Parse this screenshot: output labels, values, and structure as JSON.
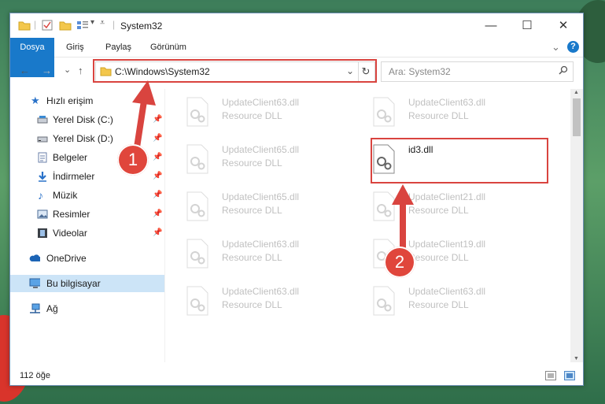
{
  "window": {
    "title": "System32",
    "controls": {
      "minimize": "—",
      "maximize": "☐",
      "close": "✕"
    }
  },
  "ribbon": {
    "tabs": [
      "Dosya",
      "Giriş",
      "Paylaş",
      "Görünüm"
    ],
    "collapse_glyph": "⌄",
    "help_glyph": "?"
  },
  "address": {
    "path": "C:\\Windows\\System32",
    "search_placeholder": "Ara: System32",
    "dropdown_glyph": "⌄",
    "refresh_glyph": "↻"
  },
  "nav_buttons": {
    "back": "←",
    "forward": "→",
    "recent": "⌄",
    "up": "↑"
  },
  "sidebar": {
    "items": [
      {
        "label": "Hızlı erişim",
        "icon": "star-icon",
        "pinned": false
      },
      {
        "label": "Yerel Disk (C:)",
        "icon": "drive-icon",
        "pinned": true
      },
      {
        "label": "Yerel Disk (D:)",
        "icon": "drive-icon",
        "pinned": true
      },
      {
        "label": "Belgeler",
        "icon": "documents-icon",
        "pinned": true
      },
      {
        "label": "İndirmeler",
        "icon": "download-icon",
        "pinned": true
      },
      {
        "label": "Müzik",
        "icon": "music-icon",
        "pinned": true
      },
      {
        "label": "Resimler",
        "icon": "pictures-icon",
        "pinned": true
      },
      {
        "label": "Videolar",
        "icon": "video-icon",
        "pinned": true
      },
      {
        "label": "OneDrive",
        "icon": "cloud-icon",
        "pinned": false
      },
      {
        "label": "Bu bilgisayar",
        "icon": "computer-icon",
        "pinned": false,
        "selected": true
      },
      {
        "label": "Ağ",
        "icon": "network-icon",
        "pinned": false
      }
    ],
    "pin_glyph": "📌"
  },
  "files": [
    {
      "name": "UpdateClient63.dll",
      "type": "Resource DLL",
      "highlighted": false
    },
    {
      "name": "UpdateClient63.dll",
      "type": "Resource DLL",
      "highlighted": false
    },
    {
      "name": "UpdateClient65.dll",
      "type": "Resource DLL",
      "highlighted": false
    },
    {
      "name": "id3.dll",
      "type": "",
      "highlighted": true
    },
    {
      "name": "UpdateClient65.dll",
      "type": "Resource DLL",
      "highlighted": false
    },
    {
      "name": "UpdateClient21.dll",
      "type": "Resource DLL",
      "highlighted": false
    },
    {
      "name": "UpdateClient63.dll",
      "type": "Resource DLL",
      "highlighted": false
    },
    {
      "name": "UpdateClient19.dll",
      "type": "Resource DLL",
      "highlighted": false
    },
    {
      "name": "UpdateClient63.dll",
      "type": "Resource DLL",
      "highlighted": false
    },
    {
      "name": "UpdateClient63.dll",
      "type": "Resource DLL",
      "highlighted": false
    }
  ],
  "status": {
    "item_count": "112 öğe"
  },
  "annotations": {
    "step1": "1",
    "step2": "2"
  },
  "colors": {
    "accent": "#1979ca",
    "annotation_red": "#d9443f",
    "selection": "#cce4f7"
  }
}
